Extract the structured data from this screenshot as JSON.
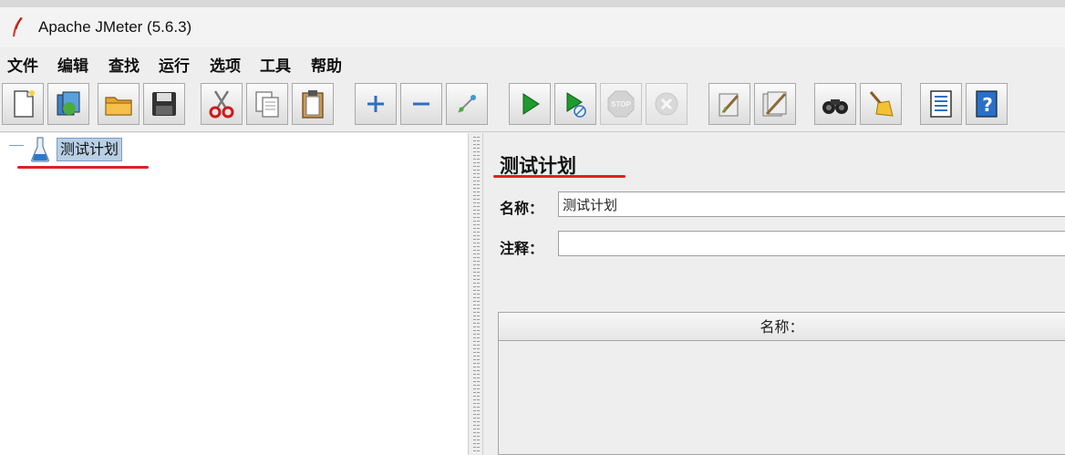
{
  "window": {
    "title": "Apache JMeter (5.6.3)"
  },
  "menu": [
    {
      "label": "文件"
    },
    {
      "label": "编辑"
    },
    {
      "label": "查找"
    },
    {
      "label": "运行"
    },
    {
      "label": "选项"
    },
    {
      "label": "工具"
    },
    {
      "label": "帮助"
    }
  ],
  "toolbar": {
    "buttons": [
      {
        "icon": "new-file-icon",
        "enabled": true
      },
      {
        "icon": "templates-icon",
        "enabled": true
      },
      {
        "icon": "open-folder-icon",
        "enabled": true
      },
      {
        "icon": "save-icon",
        "enabled": true
      },
      {
        "icon": "cut-icon",
        "enabled": true
      },
      {
        "icon": "copy-icon",
        "enabled": true
      },
      {
        "icon": "paste-icon",
        "enabled": true
      },
      {
        "icon": "expand-icon",
        "enabled": true
      },
      {
        "icon": "collapse-icon",
        "enabled": true
      },
      {
        "icon": "toggle-icon",
        "enabled": true
      },
      {
        "icon": "start-icon",
        "enabled": true
      },
      {
        "icon": "start-no-pauses-icon",
        "enabled": true
      },
      {
        "icon": "stop-icon",
        "enabled": false,
        "text": "STOP"
      },
      {
        "icon": "shutdown-icon",
        "enabled": false
      },
      {
        "icon": "clear-icon",
        "enabled": true
      },
      {
        "icon": "clear-all-icon",
        "enabled": true
      },
      {
        "icon": "search-icon",
        "enabled": true
      },
      {
        "icon": "reset-search-icon",
        "enabled": true
      },
      {
        "icon": "function-helper-icon",
        "enabled": true
      },
      {
        "icon": "help-icon",
        "enabled": true
      }
    ]
  },
  "tree": {
    "root": {
      "label": "测试计划",
      "icon": "flask-icon"
    }
  },
  "panel": {
    "title": "测试计划",
    "name_label": "名称：",
    "name_value": "测试计划",
    "comment_label": "注释：",
    "comment_value": "",
    "table": {
      "header": "名称："
    }
  },
  "colors": {
    "annotation": "#e02020",
    "selection": "#b8cfe5"
  }
}
